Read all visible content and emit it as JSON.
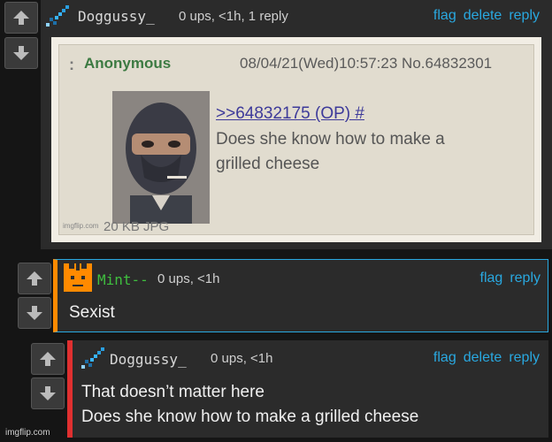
{
  "comments": [
    {
      "username": "Doggussy_",
      "meta": "0 ups, <1h, 1 reply",
      "actions": [
        "flag",
        "delete",
        "reply"
      ],
      "avatar": "pixel-sword-avatar"
    },
    {
      "username": "Mint--",
      "meta": "0 ups, <1h",
      "actions": [
        "flag",
        "reply"
      ],
      "text": "Sexist",
      "avatar": "orange-cat-avatar"
    },
    {
      "username": "Doggussy_",
      "meta": "0 ups, <1h",
      "actions": [
        "flag",
        "delete",
        "reply"
      ],
      "text_line1": "That doesn’t matter here",
      "text_line2": "Does she know how to make a grilled cheese",
      "avatar": "pixel-sword-avatar"
    }
  ],
  "image_post": {
    "dots": ":",
    "name": "Anonymous",
    "datetime": "08/04/21(Wed)10:57:23 No.64832301",
    "reply_link": ">>64832175 (OP) #",
    "line1": "Does she know how to make a",
    "line2": "grilled cheese",
    "watermark": "imgflip.com",
    "fileinfo": "20 KB JPG"
  },
  "footer_watermark": "imgflip.com",
  "colors": {
    "link": "#29a8e0",
    "mint_username": "#3fbf3f",
    "mint_border": "#ff8a00",
    "reply_border": "#e03030",
    "highlight_border": "#29a8e0"
  }
}
